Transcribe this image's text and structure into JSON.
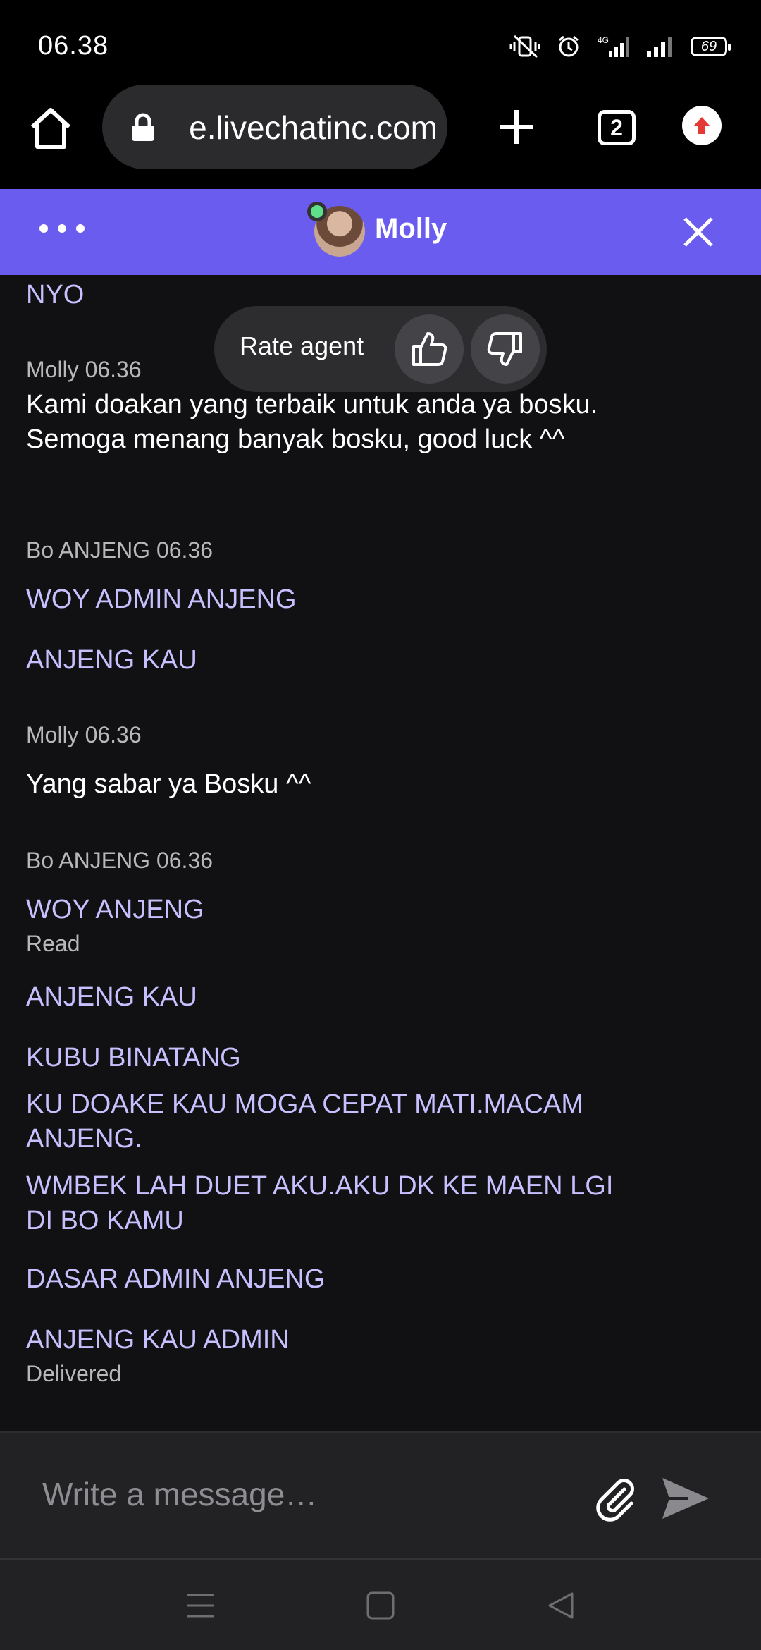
{
  "status_bar": {
    "time": "06.38",
    "battery": "69",
    "network": "4G"
  },
  "browser": {
    "url": "e.livechatinc.com",
    "tab_count": "2"
  },
  "chat_header": {
    "agent_name": "Molly",
    "accent_color": "#6b5cf0"
  },
  "rate_popup": {
    "label": "Rate agent"
  },
  "messages": {
    "m0": "NYO",
    "meta1": "Molly 06.36",
    "m1": "Kami doakan yang terbaik untuk anda ya bosku. Semoga menang banyak bosku, good luck ^^",
    "meta2": "Bo ANJENG 06.36",
    "m2": "WOY ADMIN ANJENG",
    "m3": "ANJENG KAU",
    "meta3": "Molly 06.36",
    "m4": "Yang sabar ya Bosku ^^",
    "meta4": "Bo ANJENG 06.36",
    "m5": "WOY ANJENG",
    "status_read": "Read",
    "m6": "ANJENG KAU",
    "m7": "KUBU BINATANG",
    "m8": "KU DOAKE KAU MOGA CEPAT MATI.MACAM ANJENG.",
    "m9": "WMBEK LAH DUET AKU.AKU DK KE MAEN LGI DI BO KAMU",
    "m10": "DASAR ADMIN ANJENG",
    "m11": "ANJENG KAU ADMIN",
    "status_delivered": "Delivered"
  },
  "composer": {
    "placeholder": "Write a message…"
  },
  "icons": {
    "home": "home-icon",
    "lock": "lock-icon",
    "add_tab": "plus-icon",
    "update": "update-arrow-icon",
    "menu": "more-dots-icon",
    "close": "close-icon",
    "thumbs_up": "thumbs-up-icon",
    "thumbs_down": "thumbs-down-icon",
    "attach": "paperclip-icon",
    "send": "send-icon"
  }
}
